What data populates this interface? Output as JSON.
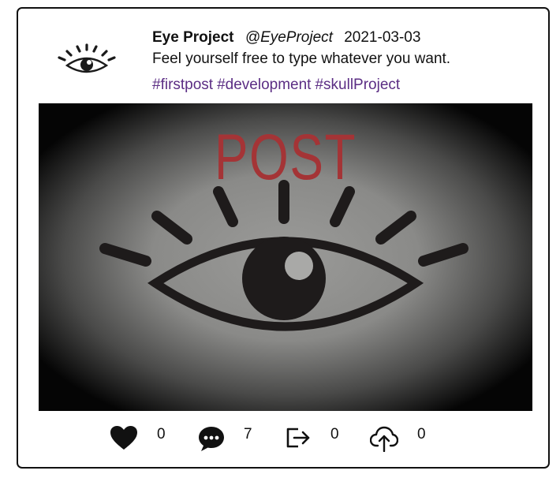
{
  "post": {
    "author_name": "Eye Project",
    "author_handle": "@EyeProject",
    "date": "2021-03-03",
    "text": "Feel yourself free to type whatever you want.",
    "hashtags": [
      "#firstpost",
      "#development",
      "#skullProject"
    ],
    "image": {
      "caption_text": "POST",
      "caption_color": "#a43436",
      "icon": "eye-icon"
    }
  },
  "actions": [
    {
      "name": "like",
      "icon": "heart-icon",
      "count": "0"
    },
    {
      "name": "comment",
      "icon": "comment-icon",
      "count": "7"
    },
    {
      "name": "share",
      "icon": "share-icon",
      "count": "0"
    },
    {
      "name": "upload",
      "icon": "cloud-upload-icon",
      "count": "0"
    }
  ],
  "colors": {
    "hashtag": "#5b2d84",
    "text": "#111111",
    "border": "#111111"
  }
}
